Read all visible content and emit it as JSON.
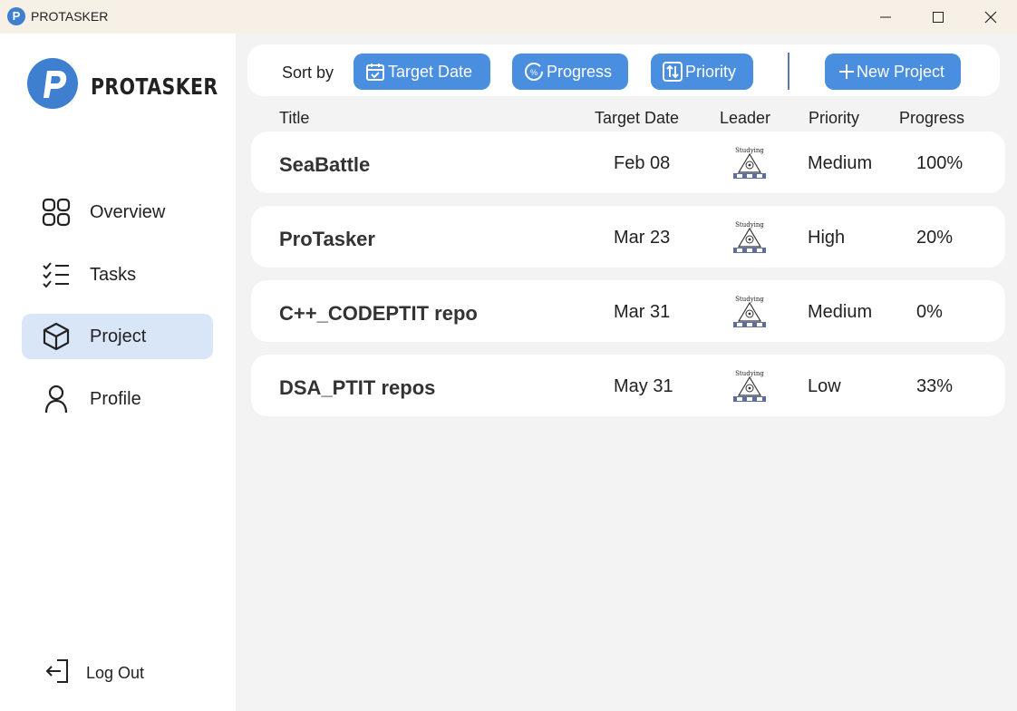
{
  "window": {
    "title": "PROTASKER",
    "app_icon_letter": "P"
  },
  "sidebar": {
    "logo_text": "PROTASKER",
    "items": [
      {
        "label": "Overview",
        "icon": "grid-icon",
        "active": false
      },
      {
        "label": "Tasks",
        "icon": "checklist-icon",
        "active": false
      },
      {
        "label": "Project",
        "icon": "cube-icon",
        "active": true
      },
      {
        "label": "Profile",
        "icon": "user-icon",
        "active": false
      }
    ],
    "logout_label": "Log Out"
  },
  "toolbar": {
    "sort_by_label": "Sort by",
    "sort_target_date": "Target Date",
    "sort_progress": "Progress",
    "sort_priority": "Priority",
    "new_project": "+ New Project",
    "new_project_label": "New Project",
    "accent_color": "#4a8ee0"
  },
  "table": {
    "columns": [
      "Title",
      "Target Date",
      "Leader",
      "Priority",
      "Progress"
    ],
    "rows": [
      {
        "title": "SeaBattle",
        "target_date": "Feb 08",
        "leader_avatar": "Studying",
        "priority": "Medium",
        "progress": "100%"
      },
      {
        "title": "ProTasker",
        "target_date": "Mar 23",
        "leader_avatar": "Studying",
        "priority": "High",
        "progress": "20%"
      },
      {
        "title": "C++_CODEPTIT repo",
        "target_date": "Mar 31",
        "leader_avatar": "Studying",
        "priority": "Medium",
        "progress": "0%"
      },
      {
        "title": "DSA_PTIT repos",
        "target_date": "May 31",
        "leader_avatar": "Studying",
        "priority": "Low",
        "progress": "33%"
      }
    ]
  }
}
